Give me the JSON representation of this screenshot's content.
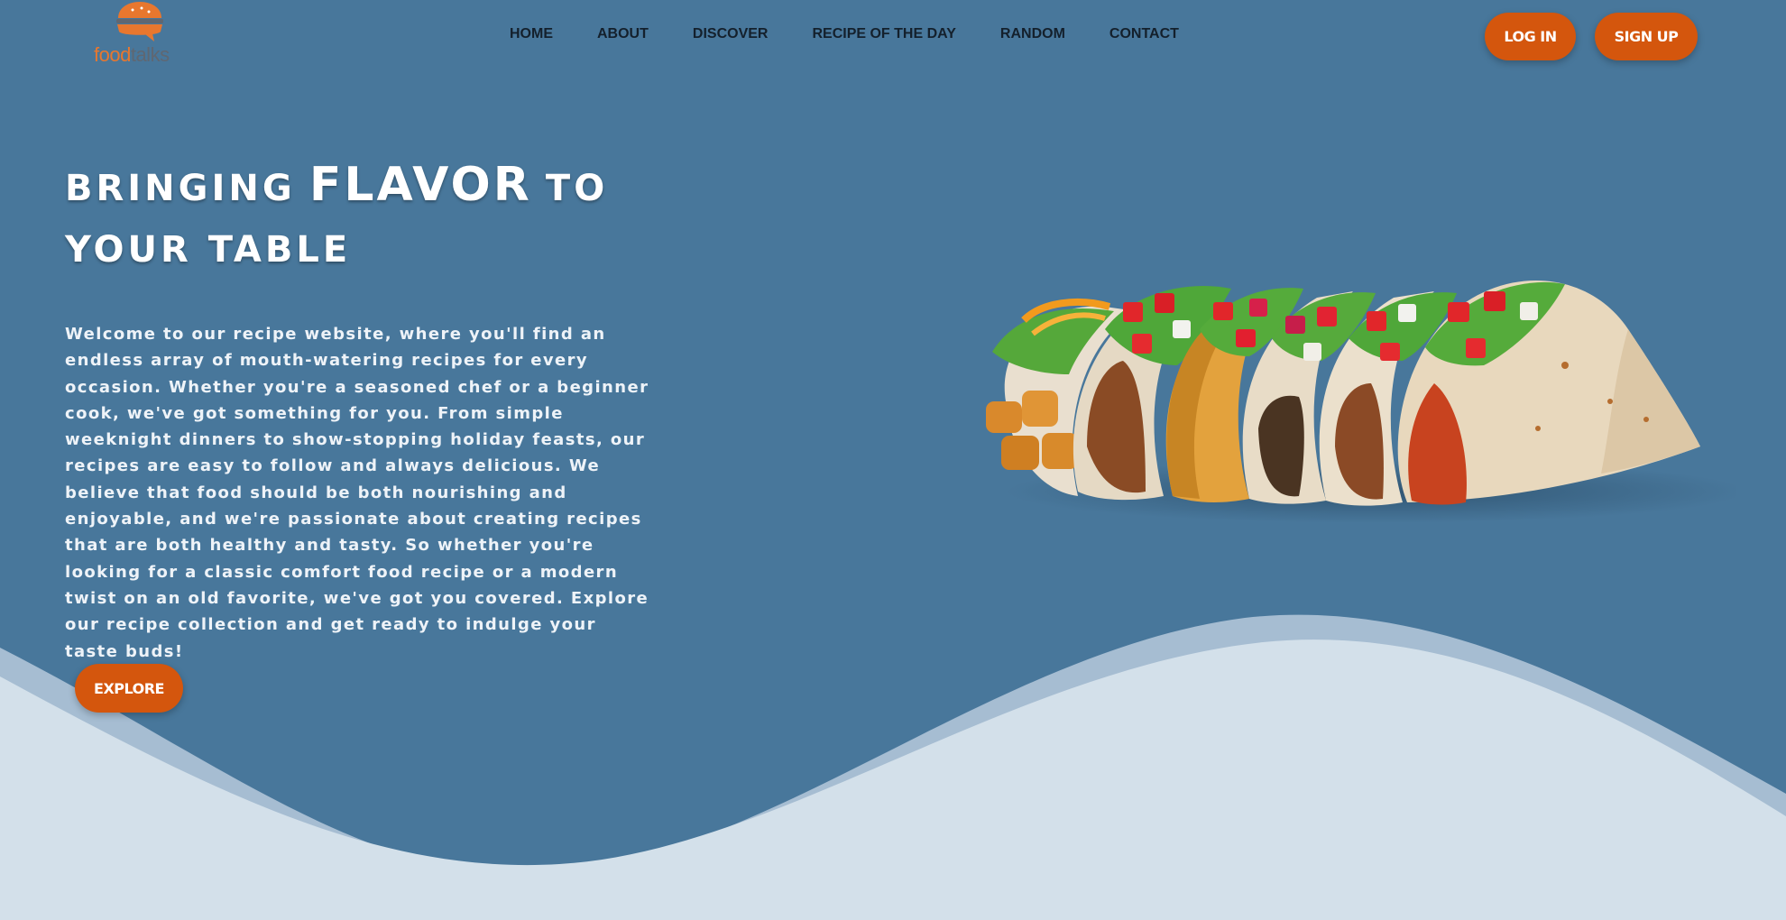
{
  "brand": {
    "logo_part1": "food",
    "logo_part2": "talks"
  },
  "nav": {
    "items": [
      "HOME",
      "ABOUT",
      "DISCOVER",
      "RECIPE OF THE DAY",
      "RANDOM",
      "CONTACT"
    ]
  },
  "auth": {
    "login_label": "LOG IN",
    "signup_label": "SIGN UP"
  },
  "hero": {
    "title_part1": "BRINGING",
    "title_part2": "FLAVOR",
    "title_part3": "TO",
    "title_part4": "YOUR TABLE",
    "description": "Welcome to our recipe website, where you'll find an endless array of mouth-watering recipes for every occasion. Whether you're a seasoned chef or a beginner cook, we've got something for you. From simple weeknight dinners to show-stopping holiday feasts, our recipes are easy to follow and always delicious. We believe that food should be both nourishing and enjoyable, and we're passionate about creating recipes that are both healthy and tasty. So whether you're looking for a classic comfort food recipe or a modern twist on an old favorite, we've got you covered. Explore our recipe collection and get ready to indulge your taste buds!",
    "explore_label": "EXPLORE"
  },
  "colors": {
    "background": "#48779b",
    "accent": "#d4560d",
    "wave_mid": "#a6bdd2",
    "wave_light": "#d3e0ea"
  }
}
